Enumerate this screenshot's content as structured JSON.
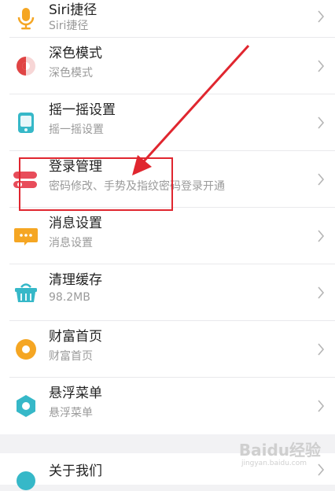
{
  "items": [
    {
      "title": "Siri捷径",
      "subtitle": "Siri捷径",
      "icon": "microphone-icon"
    },
    {
      "title": "深色模式",
      "subtitle": "深色模式",
      "icon": "dark-mode-icon"
    },
    {
      "title": "摇一摇设置",
      "subtitle": "摇一摇设置",
      "icon": "shake-phone-icon"
    },
    {
      "title": "登录管理",
      "subtitle": "密码修改、手势及指纹密码登录开通",
      "icon": "login-toggle-icon"
    },
    {
      "title": "消息设置",
      "subtitle": "消息设置",
      "icon": "message-icon"
    },
    {
      "title": "清理缓存",
      "subtitle": "98.2MB",
      "icon": "basket-icon"
    },
    {
      "title": "财富首页",
      "subtitle": "财富首页",
      "icon": "coin-icon"
    },
    {
      "title": "悬浮菜单",
      "subtitle": "悬浮菜单",
      "icon": "hexagon-icon"
    }
  ],
  "about": {
    "title": "关于我们",
    "icon": "info-icon"
  },
  "watermark": {
    "text": "Baidu经验",
    "sub": "jingyan.baidu.com"
  },
  "colors": {
    "accent_red": "#e0262f",
    "orange": "#f5a623",
    "teal": "#36b8c8"
  }
}
